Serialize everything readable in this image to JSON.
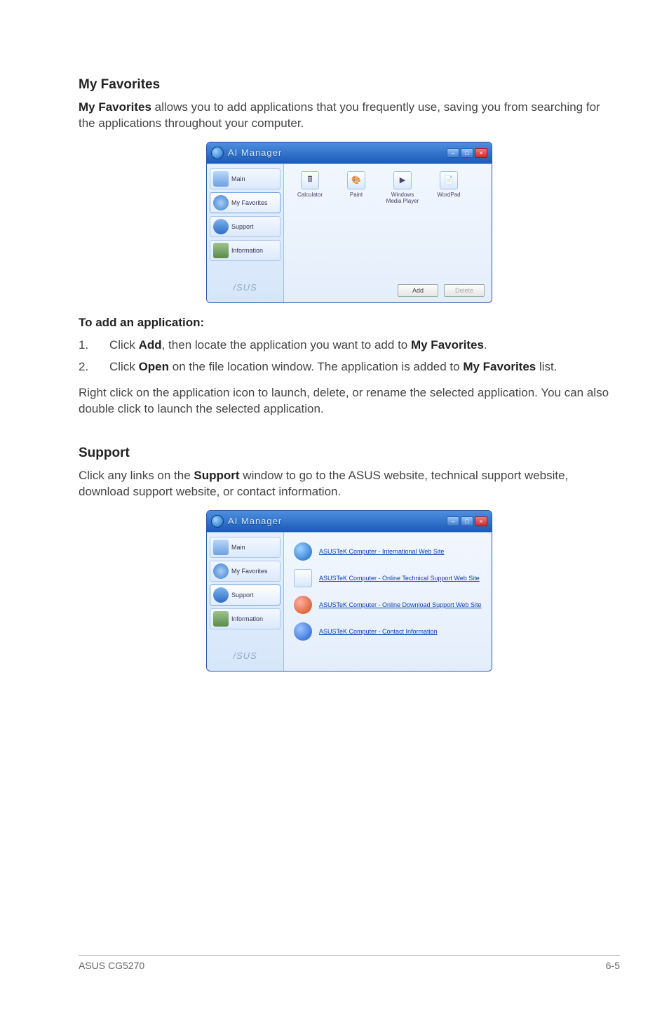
{
  "sections": {
    "myFavorites": {
      "heading": "My Favorites",
      "intro_prefix_bold": "My Favorites",
      "intro_rest": " allows you to add applications that you frequently use, saving you from searching for the applications throughout your computer.",
      "subhead": "To add an application:",
      "steps": [
        {
          "num": "1.",
          "prefix": "Click ",
          "b1": "Add",
          "mid": ", then locate the application you want to add to ",
          "b2": "My Favorites",
          "suffix": "."
        },
        {
          "num": "2.",
          "prefix": "Click ",
          "b1": "Open",
          "mid": " on the file location window. The application is added to ",
          "b2": "My Favorites",
          "suffix": " list."
        }
      ],
      "post_text": "Right click on the application icon to launch, delete, or rename the selected application. You can also double click to launch the selected application."
    },
    "support": {
      "heading": "Support",
      "intro_a": "Click any links on the ",
      "intro_bold": "Support",
      "intro_b": " window to go to the ASUS website, technical support website, download support website, or contact information."
    }
  },
  "ai_window": {
    "title": "AI Manager",
    "sidebar": {
      "main": "Main",
      "my_favorites": "My\nFavorites",
      "support": "Support",
      "information": "Information"
    },
    "brand": "/SUS",
    "win_btns": {
      "min": "–",
      "max": "□",
      "close": "×"
    },
    "favorites": {
      "items": [
        {
          "label": "Calculator",
          "glyph": "🖩"
        },
        {
          "label": "Paint",
          "glyph": "🎨"
        },
        {
          "label": "Windows Media Player",
          "glyph": "▶"
        },
        {
          "label": "WordPad",
          "glyph": "📄"
        }
      ],
      "add_btn": "Add",
      "delete_btn": "Delete"
    },
    "support_links": [
      "ASUSTeK Computer - International Web Site",
      "ASUSTeK Computer - Online Technical Support Web Site",
      "ASUSTeK Computer - Online Download Support Web Site",
      "ASUSTeK Computer - Contact Information"
    ]
  },
  "footer": {
    "left": "ASUS CG5270",
    "right": "6-5"
  }
}
